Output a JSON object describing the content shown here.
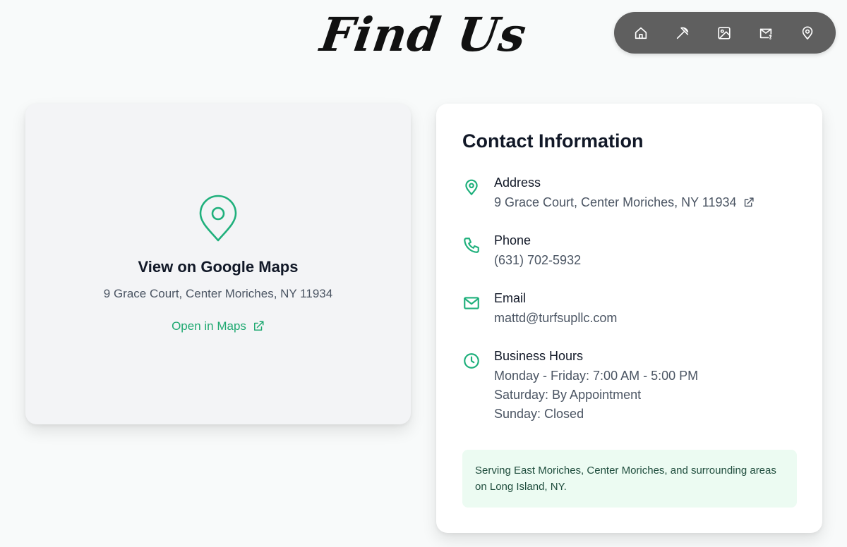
{
  "page": {
    "title": "Find Us"
  },
  "nav": {
    "items": [
      {
        "name": "home",
        "icon": "home-icon"
      },
      {
        "name": "services",
        "icon": "pickaxe-icon"
      },
      {
        "name": "gallery",
        "icon": "image-icon"
      },
      {
        "name": "contact",
        "icon": "mail-question-icon"
      },
      {
        "name": "find-us",
        "icon": "map-pin-icon"
      }
    ]
  },
  "map_card": {
    "heading": "View on Google Maps",
    "address": "9 Grace Court, Center Moriches, NY 11934",
    "link_label": "Open in Maps"
  },
  "contact": {
    "title": "Contact Information",
    "address": {
      "label": "Address",
      "value": "9 Grace Court, Center Moriches, NY 11934"
    },
    "phone": {
      "label": "Phone",
      "value": "(631) 702-5932"
    },
    "email": {
      "label": "Email",
      "value": "mattd@turfsupllc.com"
    },
    "hours": {
      "label": "Business Hours",
      "lines": [
        "Monday - Friday: 7:00 AM - 5:00 PM",
        "Saturday: By Appointment",
        "Sunday: Closed"
      ]
    },
    "service_area": "Serving East Moriches, Center Moriches, and surrounding areas on Long Island, NY."
  },
  "colors": {
    "accent": "#1fb07c",
    "nav_background": "#5f5f5f",
    "service_box": "#ecfbf2"
  }
}
